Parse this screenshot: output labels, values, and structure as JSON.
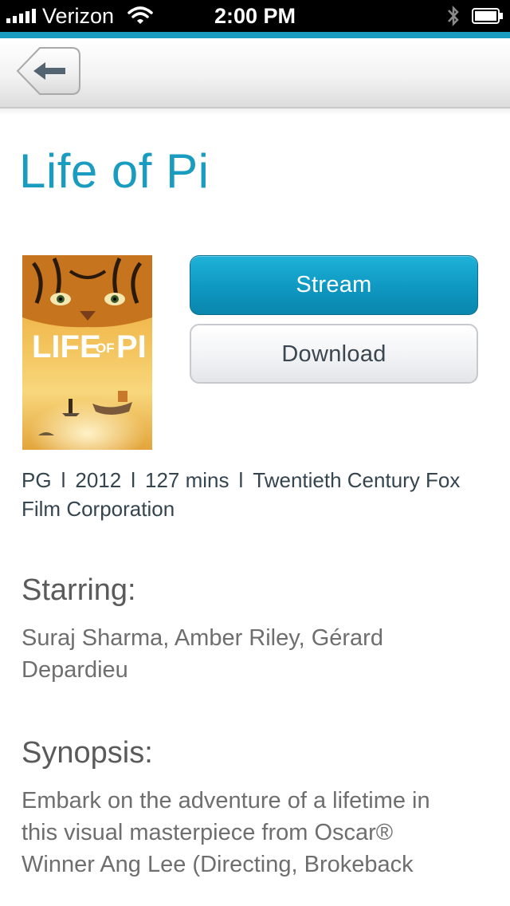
{
  "status_bar": {
    "carrier": "Verizon",
    "time": "2:00 PM",
    "icons": [
      "signal-icon",
      "wifi-icon",
      "bluetooth-icon",
      "battery-icon"
    ]
  },
  "nav": {
    "back_icon": "back-arrow-icon"
  },
  "movie": {
    "title": "Life of Pi",
    "poster": {
      "text_life": "LIFE",
      "text_of": "OF",
      "text_pi": "PI"
    },
    "buttons": {
      "stream_label": "Stream",
      "download_label": "Download"
    },
    "meta": {
      "rating": "PG",
      "separator": "l",
      "year": "2012",
      "runtime": "127 mins",
      "studio": "Twentieth Century Fox Film Corporation"
    },
    "starring": {
      "heading": "Starring:",
      "text": "Suraj Sharma, Amber Riley, Gérard Depardieu"
    },
    "synopsis": {
      "heading": "Synopsis:",
      "text": "Embark on the adventure of a lifetime in this visual masterpiece from Oscar® Winner Ang Lee (Directing, Brokeback"
    }
  },
  "colors": {
    "accent": "#1a9cc0",
    "stream_button": "#0f9ac3",
    "body_text": "#6e6e6e",
    "meta_text": "#34454f"
  }
}
